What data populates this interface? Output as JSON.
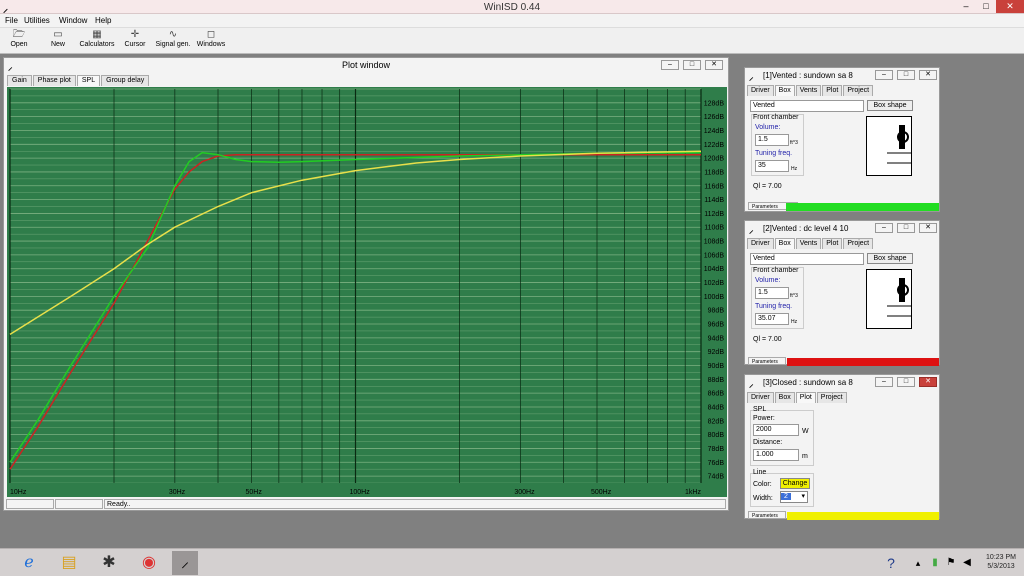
{
  "app": {
    "title": "WinISD 0.44",
    "controls": {
      "minimize": "–",
      "maximize": "□",
      "close": "✕"
    }
  },
  "menu": [
    "File",
    "Utilities",
    "Window",
    "Help"
  ],
  "toolbar": [
    {
      "label": "Open",
      "icon": "folder-icon"
    },
    {
      "label": "New",
      "icon": "new-file-icon"
    },
    {
      "label": "Calculators",
      "icon": "calculator-icon"
    },
    {
      "label": "Cursor",
      "icon": "cursor-icon"
    },
    {
      "label": "Signal gen.",
      "icon": "signal-gen-icon"
    },
    {
      "label": "Windows",
      "icon": "windows-icon"
    }
  ],
  "plot_window": {
    "title": "Plot window",
    "tabs": [
      "Gain",
      "Phase plot",
      "SPL",
      "Group delay"
    ],
    "active_tab": "SPL",
    "status": "Ready..",
    "wbtns": {
      "minimize": "–",
      "maximize": "□",
      "close": "✕"
    }
  },
  "chart_data": {
    "type": "line",
    "x_scale": "log",
    "xlim": [
      10,
      1000
    ],
    "ylim": [
      73,
      130
    ],
    "x_ticks": [
      {
        "v": 10,
        "label": "10Hz"
      },
      {
        "v": 30,
        "label": "30Hz"
      },
      {
        "v": 50,
        "label": "50Hz"
      },
      {
        "v": 100,
        "label": "100Hz"
      },
      {
        "v": 300,
        "label": "300Hz"
      },
      {
        "v": 500,
        "label": "500Hz"
      },
      {
        "v": 1000,
        "label": "1kHz"
      }
    ],
    "y_ticks": [
      74,
      76,
      78,
      80,
      82,
      84,
      86,
      88,
      90,
      92,
      94,
      96,
      98,
      100,
      102,
      104,
      106,
      108,
      110,
      112,
      114,
      116,
      118,
      120,
      122,
      124,
      126,
      128
    ],
    "y_unit": "dB",
    "grid": true,
    "background": "#2f7d4a",
    "series": [
      {
        "color": "#cc2222",
        "x": [
          10,
          12,
          15,
          20,
          25,
          30,
          33,
          36,
          40,
          45,
          50,
          70,
          100,
          200,
          500,
          1000
        ],
        "y": [
          75,
          81,
          89,
          99,
          108,
          115.5,
          118,
          119.5,
          120.3,
          120.5,
          120.5,
          120.5,
          120.5,
          120.5,
          120.5,
          120.5
        ]
      },
      {
        "color": "#22cc22",
        "x": [
          10,
          12,
          15,
          20,
          25,
          30,
          33,
          36,
          40,
          45,
          50,
          60,
          70,
          100,
          200,
          500,
          1000
        ],
        "y": [
          76,
          82,
          90,
          100,
          107,
          116,
          119.5,
          120.8,
          120.5,
          119.8,
          119.5,
          119.4,
          119.5,
          119.8,
          120.3,
          120.7,
          120.8
        ]
      },
      {
        "color": "#e8e04a",
        "x": [
          10,
          15,
          20,
          25,
          30,
          40,
          50,
          70,
          100,
          150,
          200,
          300,
          500,
          1000
        ],
        "y": [
          94.5,
          100,
          104,
          107.5,
          110,
          113,
          115,
          116.8,
          118.2,
          119.3,
          119.8,
          120.3,
          120.7,
          121
        ]
      }
    ]
  },
  "drivers": [
    {
      "title": "[1]Vented : sundown sa 8",
      "tabs": [
        "Driver",
        "Box",
        "Vents",
        "Plot",
        "Project"
      ],
      "active_tab": "Box",
      "box_type": "Vented",
      "box_shape_button": "Box shape",
      "section_label": "Front chamber",
      "volume_label": "Volume:",
      "volume": "1.5",
      "volume_unit": "ft^3",
      "tuning_label": "Tuning freq.",
      "tuning": "35",
      "tuning_unit": "Hz",
      "ql": "Ql = 7.00",
      "params_label": "Parameters",
      "color": "#22dd22"
    },
    {
      "title": "[2]Vented : dc level 4 10",
      "tabs": [
        "Driver",
        "Box",
        "Vents",
        "Plot",
        "Project"
      ],
      "active_tab": "Box",
      "box_type": "Vented",
      "box_shape_button": "Box shape",
      "section_label": "Front chamber",
      "volume_label": "Volume:",
      "volume": "1.5",
      "volume_unit": "ft^3",
      "tuning_label": "Tuning freq.",
      "tuning": "35.07",
      "tuning_unit": "Hz",
      "ql": "Ql = 7.00",
      "params_label": "Parameters",
      "color": "#dd1111"
    }
  ],
  "closed_window": {
    "title": "[3]Closed : sundown sa 8",
    "tabs": [
      "Driver",
      "Box",
      "Plot",
      "Project"
    ],
    "active_tab": "Plot",
    "spl_label": "SPL",
    "power_label": "Power:",
    "power": "2000",
    "power_unit": "W",
    "distance_label": "Distance:",
    "distance": "1.000",
    "distance_unit": "m",
    "line_label": "Line",
    "color_label": "Color:",
    "change_button": "Change",
    "width_label": "Width:",
    "width_value": "2",
    "params_label": "Parameters",
    "color": "#f0f000"
  },
  "taskbar": {
    "apps": [
      "ie-icon",
      "file-explorer-icon",
      "app-icon",
      "chrome-icon",
      "winisd-icon"
    ],
    "time": "10:23 PM",
    "date": "5/3/2013"
  }
}
